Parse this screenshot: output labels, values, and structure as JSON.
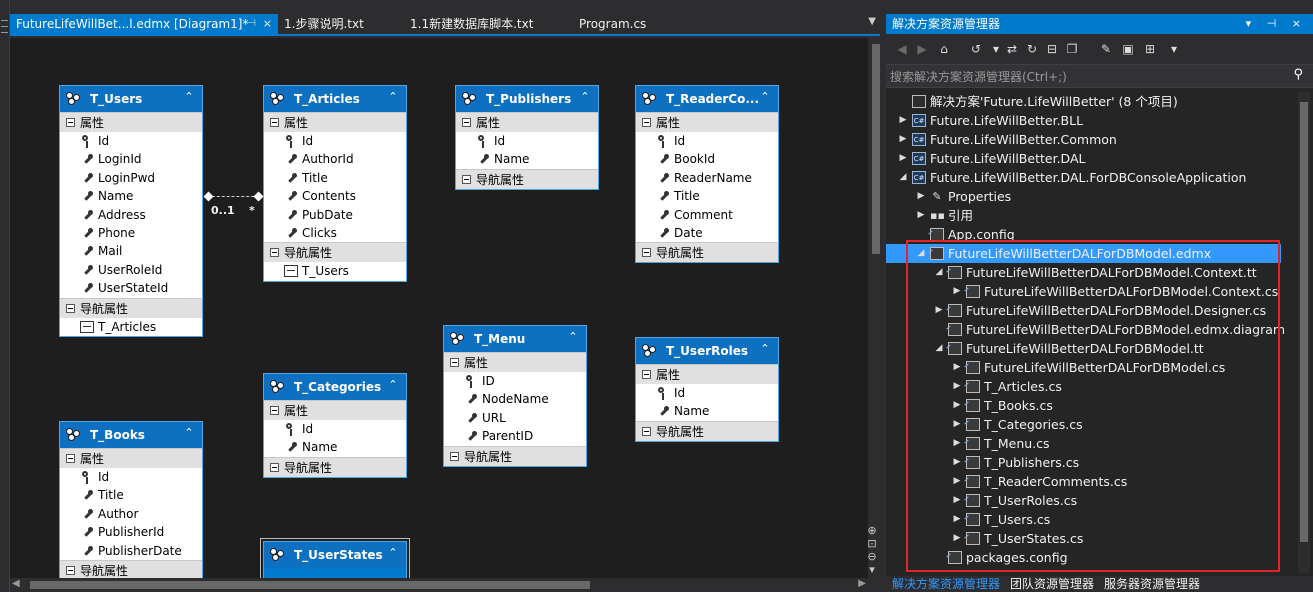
{
  "doc_tabs": [
    {
      "label": "FutureLifeWillBet...l.edmx [Diagram1]*",
      "pin": "⊣",
      "close": "×"
    },
    {
      "label": "1.步骤说明.txt"
    },
    {
      "label": "1.1新建数据库脚本.txt"
    },
    {
      "label": "Program.cs"
    }
  ],
  "tab_overflow": "▼",
  "designer": {
    "section_properties": "属性",
    "section_navigation": "导航属性",
    "collapse_glyph": "⌃",
    "entities": {
      "users": {
        "name": "T_Users",
        "keys": [
          "Id"
        ],
        "props": [
          "LoginId",
          "LoginPwd",
          "Name",
          "Address",
          "Phone",
          "Mail",
          "UserRoleId",
          "UserStateId"
        ],
        "nav": [
          "T_Articles"
        ]
      },
      "articles": {
        "name": "T_Articles",
        "keys": [
          "Id"
        ],
        "props": [
          "AuthorId",
          "Title",
          "Contents",
          "PubDate",
          "Clicks"
        ],
        "nav": [
          "T_Users"
        ]
      },
      "publishers": {
        "name": "T_Publishers",
        "keys": [
          "Id"
        ],
        "props": [
          "Name"
        ],
        "nav": []
      },
      "readercomments": {
        "name": "T_ReaderCo...",
        "keys": [
          "Id"
        ],
        "props": [
          "BookId",
          "ReaderName",
          "Title",
          "Comment",
          "Date"
        ],
        "nav": []
      },
      "categories": {
        "name": "T_Categories",
        "keys": [
          "Id"
        ],
        "props": [
          "Name"
        ],
        "nav": []
      },
      "menu": {
        "name": "T_Menu",
        "keys": [
          "ID"
        ],
        "props": [
          "NodeName",
          "URL",
          "ParentID"
        ],
        "nav": []
      },
      "userroles": {
        "name": "T_UserRoles",
        "keys": [
          "Id"
        ],
        "props": [
          "Name"
        ],
        "nav": []
      },
      "books": {
        "name": "T_Books",
        "keys": [
          "Id"
        ],
        "props": [
          "Title",
          "Author",
          "PublisherId",
          "PublisherDate"
        ],
        "nav": []
      },
      "userstates": {
        "name": "T_UserStates",
        "keys": [],
        "props": [],
        "nav": []
      }
    },
    "association": {
      "left_label": "0..1",
      "right_label": "*"
    }
  },
  "solution_explorer": {
    "title": "解决方案资源管理器",
    "title_controls": "▾ ⊣ ×",
    "search_placeholder": "搜索解决方案资源管理器(Ctrl+;)",
    "tree": [
      {
        "label": "解决方案'Future.LifeWillBetter' (8 个项目)",
        "icon": "sol",
        "exp": ""
      },
      {
        "label": "Future.LifeWillBetter.BLL",
        "icon": "cs",
        "exp": "▶"
      },
      {
        "label": "Future.LifeWillBetter.Common",
        "icon": "cs",
        "exp": "▶"
      },
      {
        "label": "Future.LifeWillBetter.DAL",
        "icon": "cs",
        "exp": "▶"
      },
      {
        "label": "Future.LifeWillBetter.DAL.ForDBConsoleApplication",
        "icon": "cs",
        "exp": "◢"
      },
      {
        "label": "Properties",
        "icon": "wrench",
        "exp": "▶"
      },
      {
        "label": "引用",
        "icon": "ref",
        "exp": "▶"
      },
      {
        "label": "App.config",
        "icon": "file",
        "exp": ""
      },
      {
        "label": "FutureLifeWillBetterDALForDBModel.edmx",
        "icon": "file",
        "exp": "◢"
      },
      {
        "label": "FutureLifeWillBetterDALForDBModel.Context.tt",
        "icon": "file",
        "exp": "◢"
      },
      {
        "label": "FutureLifeWillBetterDALForDBModel.Context.cs",
        "icon": "file",
        "exp": "▶"
      },
      {
        "label": "FutureLifeWillBetterDALForDBModel.Designer.cs",
        "icon": "file",
        "exp": "▶"
      },
      {
        "label": "FutureLifeWillBetterDALForDBModel.edmx.diagram",
        "icon": "file",
        "exp": ""
      },
      {
        "label": "FutureLifeWillBetterDALForDBModel.tt",
        "icon": "file",
        "exp": "◢"
      },
      {
        "label": "FutureLifeWillBetterDALForDBModel.cs",
        "icon": "file",
        "exp": "▶"
      },
      {
        "label": "T_Articles.cs",
        "icon": "file",
        "exp": "▶"
      },
      {
        "label": "T_Books.cs",
        "icon": "file",
        "exp": "▶"
      },
      {
        "label": "T_Categories.cs",
        "icon": "file",
        "exp": "▶"
      },
      {
        "label": "T_Menu.cs",
        "icon": "file",
        "exp": "▶"
      },
      {
        "label": "T_Publishers.cs",
        "icon": "file",
        "exp": "▶"
      },
      {
        "label": "T_ReaderComments.cs",
        "icon": "file",
        "exp": "▶"
      },
      {
        "label": "T_UserRoles.cs",
        "icon": "file",
        "exp": "▶"
      },
      {
        "label": "T_Users.cs",
        "icon": "file",
        "exp": "▶"
      },
      {
        "label": "T_UserStates.cs",
        "icon": "file",
        "exp": "▶"
      },
      {
        "label": "packages.config",
        "icon": "file",
        "exp": ""
      }
    ],
    "bottom_tabs": [
      "解决方案资源管理器",
      "团队资源管理器",
      "服务器资源管理器"
    ]
  },
  "colors": {
    "accent": "#007acc",
    "selection": "#3399ff",
    "highlight_box": "#e0242c",
    "canvas": "#1e1e1e"
  }
}
